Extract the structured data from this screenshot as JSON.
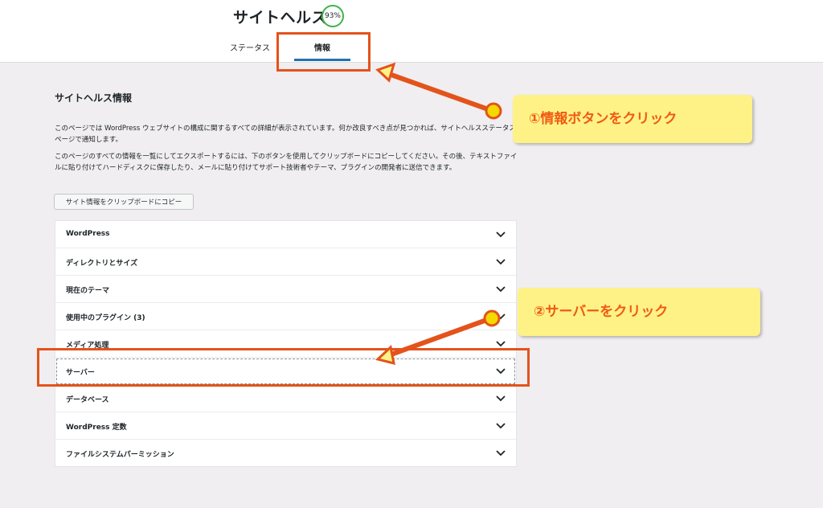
{
  "header": {
    "title": "サイトヘルス",
    "score": "93%",
    "tabs": [
      {
        "label": "ステータス"
      },
      {
        "label": "情報",
        "active": true
      }
    ]
  },
  "content": {
    "section_title": "サイトヘルス情報",
    "paragraph1": "このページでは WordPress ウェブサイトの構成に関するすべての詳細が表示されています。何か改良すべき点が見つかれば、サイトヘルスステータスページで通知します。",
    "paragraph2": "このページのすべての情報を一覧にしてエクスポートするには、下のボタンを使用してクリップボードにコピーしてください。その後、テキストファイルに貼り付けてハードディスクに保存したり、メールに貼り付けてサポート技術者やテーマ、プラグインの開発者に送信できます。",
    "copy_button": "サイト情報をクリップボードにコピー"
  },
  "accordion": [
    {
      "label": "WordPress"
    },
    {
      "label": "ディレクトリとサイズ"
    },
    {
      "label": "現在のテーマ"
    },
    {
      "label": "使用中のプラグイン (3)"
    },
    {
      "label": "メディア処理"
    },
    {
      "label": "サーバー",
      "focused": true
    },
    {
      "label": "データベース"
    },
    {
      "label": "WordPress 定数"
    },
    {
      "label": "ファイルシステムパーミッション"
    }
  ],
  "annotations": {
    "callout1": "①情報ボタンをクリック",
    "callout2": "②サーバーをクリック"
  },
  "colors": {
    "accent": "#2271b1",
    "score_ring": "#3db54a",
    "highlight": "#e3531b",
    "callout_bg": "#fef286",
    "callout_text": "#f05a14"
  }
}
